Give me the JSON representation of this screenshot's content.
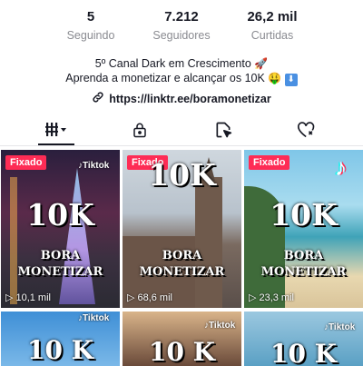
{
  "stats": [
    {
      "value": "5",
      "label": "Seguindo"
    },
    {
      "value": "7.212",
      "label": "Seguidores"
    },
    {
      "value": "26,2 mil",
      "label": "Curtidas"
    }
  ],
  "bio": {
    "line1": "5º Canal Dark em Crescimento",
    "line2": "Aprenda a monetizar e alcançar os 10K"
  },
  "link": {
    "url": "https://linktr.ee/boramonetizar"
  },
  "tabs": [
    {
      "icon": "grid-icon",
      "active": true
    },
    {
      "icon": "lock-icon",
      "active": false
    },
    {
      "icon": "repost-icon",
      "active": false
    },
    {
      "icon": "liked-heart-icon",
      "active": false
    }
  ],
  "videos": [
    {
      "pinned_label": "Fixado",
      "headline": "10K",
      "subtitle_1": "BORA",
      "subtitle_2": "MONETIZAR",
      "views": "10,1 mil"
    },
    {
      "pinned_label": "Fixado",
      "headline": "10K",
      "subtitle_1": "BORA",
      "subtitle_2": "MONETIZAR",
      "views": "68,6 mil"
    },
    {
      "pinned_label": "Fixado",
      "headline": "10K",
      "subtitle_1": "BORA",
      "subtitle_2": "MONETIZAR",
      "views": "23,3 mil"
    },
    {
      "headline": "10 K",
      "brand": "Tiktok"
    },
    {
      "headline": "10 K",
      "brand": "Tiktok"
    },
    {
      "headline": "10 K",
      "brand": "Tiktok"
    }
  ],
  "colors": {
    "pinned_badge": "#fe2c55",
    "text_primary": "#161823",
    "text_secondary": "#8a8b91"
  }
}
